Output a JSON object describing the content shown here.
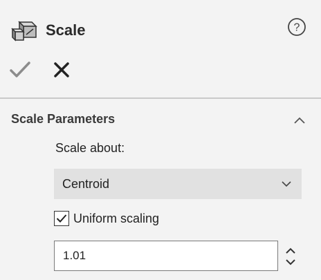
{
  "header": {
    "title": "Scale",
    "icon": "scale-feature-icon",
    "help_icon": "help-icon"
  },
  "actions": {
    "ok_icon": "checkmark-icon",
    "cancel_icon": "close-icon"
  },
  "section": {
    "title": "Scale Parameters",
    "collapse_icon": "chevron-up-icon",
    "scale_about_label": "Scale about:",
    "scale_about_value": "Centroid",
    "uniform_scaling_label": "Uniform scaling",
    "uniform_scaling_checked": true,
    "scale_factor_value": "1.01"
  },
  "colors": {
    "background": "#f3f3f3",
    "select_background": "#e1e1e1",
    "ok_disabled": "#8c8c8c"
  }
}
